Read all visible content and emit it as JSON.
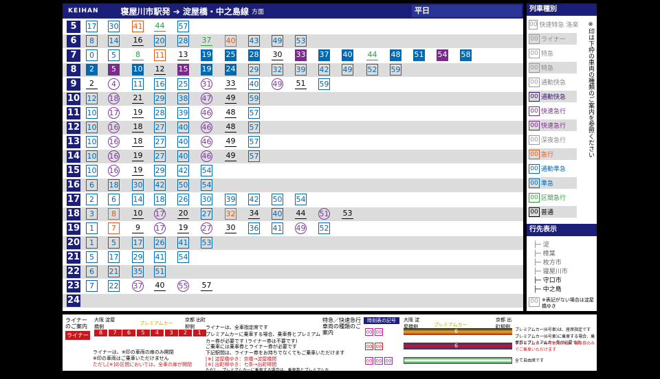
{
  "header": {
    "logo": "KEIHAN",
    "title": "寝屋川市駅発 ➔ 淀屋橋・中之島線",
    "title_suffix": "方面",
    "day": "平日"
  },
  "timetable": [
    {
      "hour": "5",
      "trains": [
        {
          "m": "17",
          "t": "semi"
        },
        {
          "m": "30",
          "t": "semi"
        },
        {
          "m": "41",
          "t": "exp"
        },
        {
          "m": "44",
          "t": "rapid"
        },
        {
          "m": "57",
          "t": "semi"
        }
      ]
    },
    {
      "hour": "6",
      "trains": [
        {
          "m": "8",
          "t": "semi"
        },
        {
          "m": "14",
          "t": "semi"
        },
        {
          "m": "16",
          "t": "local"
        },
        {
          "m": "20",
          "t": "semi"
        },
        {
          "m": "28",
          "t": "semi"
        },
        {
          "m": "37",
          "t": "rapid"
        },
        {
          "m": "40",
          "t": "exp"
        },
        {
          "m": "43",
          "t": "semi"
        },
        {
          "m": "49",
          "t": "semi"
        },
        {
          "m": "53",
          "t": "semi"
        }
      ]
    },
    {
      "hour": "7",
      "trains": [
        {
          "m": "0",
          "t": "semi"
        },
        {
          "m": "5",
          "t": "semi"
        },
        {
          "m": "8",
          "t": "rapid"
        },
        {
          "m": "11",
          "t": "exp"
        },
        {
          "m": "13",
          "t": "local"
        },
        {
          "m": "19",
          "t": "ltd"
        },
        {
          "m": "25",
          "t": "ltd"
        },
        {
          "m": "28",
          "t": "ltd"
        },
        {
          "m": "30",
          "t": "local"
        },
        {
          "m": "33",
          "t": "rexp"
        },
        {
          "m": "37",
          "t": "ltd"
        },
        {
          "m": "40",
          "t": "ltd"
        },
        {
          "m": "44",
          "t": "rapid"
        },
        {
          "m": "48",
          "t": "ltd"
        },
        {
          "m": "51",
          "t": "ltd"
        },
        {
          "m": "54",
          "t": "rexp"
        },
        {
          "m": "58",
          "t": "ltd"
        }
      ]
    },
    {
      "hour": "8",
      "trains": [
        {
          "m": "2",
          "t": "ltd"
        },
        {
          "m": "5",
          "t": "rexp"
        },
        {
          "m": "10",
          "t": "ltd"
        },
        {
          "m": "12",
          "t": "local"
        },
        {
          "m": "15",
          "t": "rexp"
        },
        {
          "m": "19",
          "t": "ltd"
        },
        {
          "m": "24",
          "t": "ltd"
        },
        {
          "m": "29",
          "t": "semi"
        },
        {
          "m": "32",
          "t": "semi"
        },
        {
          "m": "39",
          "t": "semi"
        },
        {
          "m": "42",
          "t": "semi"
        },
        {
          "m": "49",
          "t": "semi"
        },
        {
          "m": "52",
          "t": "semi"
        },
        {
          "m": "59",
          "t": "semi"
        }
      ]
    },
    {
      "hour": "9",
      "trains": [
        {
          "m": "2",
          "t": "local"
        },
        {
          "m": "4",
          "t": "sub"
        },
        {
          "m": "11",
          "t": "semi"
        },
        {
          "m": "16",
          "t": "semi"
        },
        {
          "m": "25",
          "t": "semi"
        },
        {
          "m": "31",
          "t": "sub"
        },
        {
          "m": "33",
          "t": "local"
        },
        {
          "m": "40",
          "t": "semi"
        },
        {
          "m": "49",
          "t": "sub"
        },
        {
          "m": "51",
          "t": "local"
        },
        {
          "m": "59",
          "t": "semi"
        }
      ]
    },
    {
      "hour": "10",
      "trains": [
        {
          "m": "12",
          "t": "semi"
        },
        {
          "m": "18",
          "t": "sub"
        },
        {
          "m": "21",
          "t": "local"
        },
        {
          "m": "29",
          "t": "semi"
        },
        {
          "m": "38",
          "t": "semi"
        },
        {
          "m": "47",
          "t": "sub"
        },
        {
          "m": "49",
          "t": "local"
        },
        {
          "m": "59",
          "t": "semi"
        }
      ]
    },
    {
      "hour": "11",
      "trains": [
        {
          "m": "10",
          "t": "semi"
        },
        {
          "m": "17",
          "t": "sub"
        },
        {
          "m": "19",
          "t": "local"
        },
        {
          "m": "28",
          "t": "semi"
        },
        {
          "m": "39",
          "t": "semi"
        },
        {
          "m": "46",
          "t": "sub"
        },
        {
          "m": "48",
          "t": "local"
        },
        {
          "m": "57",
          "t": "semi"
        }
      ]
    },
    {
      "hour": "12",
      "trains": [
        {
          "m": "10",
          "t": "semi"
        },
        {
          "m": "16",
          "t": "sub"
        },
        {
          "m": "18",
          "t": "local"
        },
        {
          "m": "27",
          "t": "semi"
        },
        {
          "m": "40",
          "t": "semi"
        },
        {
          "m": "46",
          "t": "sub"
        },
        {
          "m": "48",
          "t": "local"
        },
        {
          "m": "57",
          "t": "semi"
        }
      ]
    },
    {
      "hour": "13",
      "trains": [
        {
          "m": "10",
          "t": "semi"
        },
        {
          "m": "16",
          "t": "sub"
        },
        {
          "m": "18",
          "t": "local"
        },
        {
          "m": "27",
          "t": "semi"
        },
        {
          "m": "40",
          "t": "semi"
        },
        {
          "m": "46",
          "t": "sub"
        },
        {
          "m": "49",
          "t": "local"
        },
        {
          "m": "57",
          "t": "semi"
        }
      ]
    },
    {
      "hour": "14",
      "trains": [
        {
          "m": "10",
          "t": "semi"
        },
        {
          "m": "16",
          "t": "sub"
        },
        {
          "m": "19",
          "t": "local"
        },
        {
          "m": "27",
          "t": "semi"
        },
        {
          "m": "40",
          "t": "semi"
        },
        {
          "m": "46",
          "t": "sub"
        },
        {
          "m": "49",
          "t": "local"
        },
        {
          "m": "57",
          "t": "semi"
        }
      ]
    },
    {
      "hour": "15",
      "trains": [
        {
          "m": "10",
          "t": "semi"
        },
        {
          "m": "16",
          "t": "sub"
        },
        {
          "m": "19",
          "t": "local"
        },
        {
          "m": "29",
          "t": "semi"
        },
        {
          "m": "42",
          "t": "semi"
        },
        {
          "m": "54",
          "t": "semi"
        }
      ]
    },
    {
      "hour": "16",
      "trains": [
        {
          "m": "6",
          "t": "semi"
        },
        {
          "m": "18",
          "t": "semi"
        },
        {
          "m": "30",
          "t": "semi"
        },
        {
          "m": "42",
          "t": "semi"
        },
        {
          "m": "50",
          "t": "semi"
        },
        {
          "m": "54",
          "t": "semi"
        }
      ]
    },
    {
      "hour": "17",
      "trains": [
        {
          "m": "2",
          "t": "semi"
        },
        {
          "m": "6",
          "t": "semi"
        },
        {
          "m": "14",
          "t": "semi"
        },
        {
          "m": "18",
          "t": "semi"
        },
        {
          "m": "26",
          "t": "semi"
        },
        {
          "m": "30",
          "t": "semi"
        },
        {
          "m": "39",
          "t": "semi"
        },
        {
          "m": "42",
          "t": "semi"
        },
        {
          "m": "50",
          "t": "semi"
        },
        {
          "m": "54",
          "t": "semi"
        }
      ]
    },
    {
      "hour": "18",
      "trains": [
        {
          "m": "3",
          "t": "semi"
        },
        {
          "m": "8",
          "t": "exp"
        },
        {
          "m": "10",
          "t": "local"
        },
        {
          "m": "17",
          "t": "sub"
        },
        {
          "m": "20",
          "t": "local"
        },
        {
          "m": "27",
          "t": "semi"
        },
        {
          "m": "32",
          "t": "exp"
        },
        {
          "m": "34",
          "t": "local"
        },
        {
          "m": "40",
          "t": "semi"
        },
        {
          "m": "44",
          "t": "local"
        },
        {
          "m": "51",
          "t": "sub"
        },
        {
          "m": "53",
          "t": "local"
        }
      ]
    },
    {
      "hour": "19",
      "trains": [
        {
          "m": "1",
          "t": "semi"
        },
        {
          "m": "7",
          "t": "exp"
        },
        {
          "m": "9",
          "t": "local"
        },
        {
          "m": "17",
          "t": "sub"
        },
        {
          "m": "19",
          "t": "local"
        },
        {
          "m": "27",
          "t": "sub"
        },
        {
          "m": "30",
          "t": "local"
        },
        {
          "m": "36",
          "t": "semi"
        },
        {
          "m": "41",
          "t": "semi"
        },
        {
          "m": "49",
          "t": "sub"
        },
        {
          "m": "52",
          "t": "semi"
        }
      ]
    },
    {
      "hour": "20",
      "trains": [
        {
          "m": "1",
          "t": "semi"
        },
        {
          "m": "5",
          "t": "semi"
        },
        {
          "m": "17",
          "t": "semi"
        },
        {
          "m": "26",
          "t": "semi"
        },
        {
          "m": "41",
          "t": "semi"
        },
        {
          "m": "53",
          "t": "semi"
        }
      ]
    },
    {
      "hour": "21",
      "trains": [
        {
          "m": "5",
          "t": "semi"
        },
        {
          "m": "17",
          "t": "semi"
        },
        {
          "m": "29",
          "t": "semi"
        },
        {
          "m": "41",
          "t": "semi"
        },
        {
          "m": "54",
          "t": "semi"
        }
      ]
    },
    {
      "hour": "22",
      "trains": [
        {
          "m": "6",
          "t": "semi"
        },
        {
          "m": "21",
          "t": "semi"
        },
        {
          "m": "35",
          "t": "semi"
        },
        {
          "m": "51",
          "t": "semi"
        }
      ]
    },
    {
      "hour": "23",
      "trains": [
        {
          "m": "7",
          "t": "semi"
        },
        {
          "m": "22",
          "t": "semi"
        },
        {
          "m": "37",
          "t": "sub"
        },
        {
          "m": "40",
          "t": "local"
        },
        {
          "m": "55",
          "t": "sub"
        },
        {
          "m": "57",
          "t": "local"
        }
      ]
    },
    {
      "hour": "24",
      "trains": []
    }
  ],
  "legend": {
    "title": "列車種別",
    "note": "※印は下枠の車両の種類のご案内を参照ください",
    "items": [
      {
        "label": "快速特急 洛楽",
        "mark": "00",
        "color": "#999999"
      },
      {
        "label": "ライナー",
        "mark": "00",
        "color": "#999999"
      },
      {
        "label": "特急",
        "mark": "00",
        "color": "#999999"
      },
      {
        "label": "特急",
        "mark": "00",
        "color": "#999999"
      },
      {
        "label": "通勤快急",
        "mark": "00",
        "color": "#999999"
      },
      {
        "label": "通勤快急",
        "mark": "00",
        "color": "#3a1a6a"
      },
      {
        "label": "快速急行",
        "mark": "00",
        "color": "#7a2a8a"
      },
      {
        "label": "快速急行",
        "mark": "00",
        "color": "#7a2a8a"
      },
      {
        "label": "深夜急行",
        "mark": "00",
        "color": "#999999"
      },
      {
        "label": "急行",
        "mark": "00",
        "color": "#e05a1a"
      },
      {
        "label": "通勤準急",
        "mark": "00",
        "color": "#0069b4"
      },
      {
        "label": "準急",
        "mark": "00",
        "color": "#0069b4"
      },
      {
        "label": "区間急行",
        "mark": "00",
        "color": "#2e9a3a"
      },
      {
        "label": "普通",
        "mark": "00",
        "color": "#000000"
      }
    ]
  },
  "destinations": {
    "title": "行先表示",
    "items": [
      "淀",
      "樟葉",
      "枚方市",
      "寝屋川市",
      "守口市",
      "中之島"
    ],
    "note": "※表記がない場合は淀屋橋ゆき",
    "note_mark": "00"
  },
  "bottom": {
    "liner_title": "ライナーのご案内",
    "liner_badge": "ライナー",
    "osaka_label": "大阪 淀屋橋側",
    "kyoto_label": "京都 出町柳側",
    "premium_label": "プレミアムカー",
    "car_numbers": [
      "8",
      "7",
      "6",
      "5",
      "4",
      "3",
      "2",
      "1"
    ],
    "liner_note1": "ライナーは、全車指定席です",
    "liner_note2": "プレミアムカーに乗車する場合、乗車券とプレミアムカー券が必要です (ライナー券は不要です)",
    "liner_note3": "ご乗車には乗車券とライナー券が必要です",
    "liner_note4": "下記駅間は、ライナー券をお持ちでなくてもご乗車いただけます",
    "liner_note5": "[※] 淀屋橋ゆき：京橋→淀屋橋間",
    "liner_note6": "[※] 出町柳ゆき：七条→出町柳間",
    "liner_note7": "ただし、プレミアムカーに乗車する場合は、乗車券とプレミアムカー券が必要です",
    "liner_foot1": "ライナーは、※印の車両の扉のみ開閉",
    "liner_foot2": "※印の車両はご乗車いただけません",
    "liner_foot3": "ただし[※]の区間においては、全車の扉が開閉",
    "ltd_title": "特急／快速急行車両の種類のご案内",
    "symbol_label": "時刻表の記号",
    "ltd_note1": "プレミアムカー(6号車)は、座席指定です",
    "ltd_note2": "プレミアムカー(6号車)に乗車する場合、乗車券とプレミアムカー券が必要です",
    "ltd_note3": "プレミアムカー(6号車)以外は、乗車券のみでご乗車いただけます",
    "ltd_note4": "全て自由席です",
    "car6": "6"
  },
  "colors": {
    "navy": "#1c1f7a",
    "semi": "#0069b4",
    "rapid": "#2e9a3a",
    "express": "#e05a1a",
    "sub_express": "#7a3a9a",
    "liner_red": "#c8181e"
  }
}
